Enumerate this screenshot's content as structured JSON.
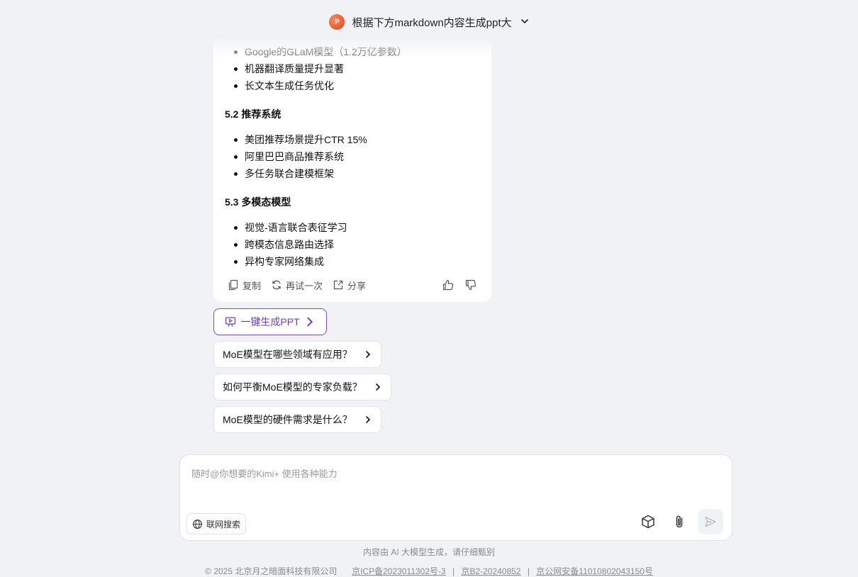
{
  "header": {
    "title": "根据下方markdown内容生成ppt大",
    "icon": "powerpoint-icon"
  },
  "message": {
    "bullets_top": [
      "Google的GLaM模型（1.2万亿参数）",
      "机器翻译质量提升显著",
      "长文本生成任务优化"
    ],
    "section_2": {
      "title": "5.2 推荐系统",
      "bullets": [
        "美团推荐场景提升CTR 15%",
        "阿里巴巴商品推荐系统",
        "多任务联合建模框架"
      ]
    },
    "section_3": {
      "title": "5.3 多模态模型",
      "bullets": [
        "视觉-语言联合表征学习",
        "跨模态信息路由选择",
        "异构专家网络集成"
      ]
    },
    "actions": {
      "copy": "复制",
      "retry": "再试一次",
      "share": "分享"
    }
  },
  "generate_ppt": {
    "label": "一键生成PPT"
  },
  "suggestions": [
    "MoE模型在哪些领域有应用？",
    "如何平衡MoE模型的专家负载？",
    "MoE模型的硬件需求是什么？"
  ],
  "input": {
    "placeholder": "随时@你想要的Kimi+ 使用各种能力",
    "value": "",
    "web_search_label": "联网搜索"
  },
  "footer": {
    "disclaimer": "内容由 AI 大模型生成，请仔细甄别",
    "copyright": "© 2025 北京月之暗面科技有限公司",
    "icp": "京ICP备2023011302号-3",
    "b2": "京B2-20240852",
    "police": "京公网安备11010802043150号",
    "separator": "|"
  },
  "colors": {
    "accent": "#6b3fd1",
    "background": "#f1f2f6"
  }
}
